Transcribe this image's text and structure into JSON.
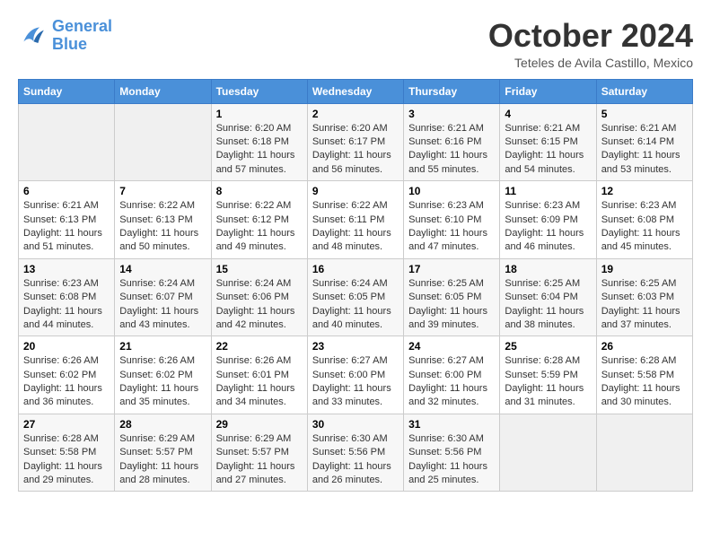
{
  "header": {
    "logo_line1": "General",
    "logo_line2": "Blue",
    "month": "October 2024",
    "location": "Teteles de Avila Castillo, Mexico"
  },
  "weekdays": [
    "Sunday",
    "Monday",
    "Tuesday",
    "Wednesday",
    "Thursday",
    "Friday",
    "Saturday"
  ],
  "weeks": [
    [
      {
        "day": "",
        "empty": true
      },
      {
        "day": "",
        "empty": true
      },
      {
        "day": "1",
        "sunrise": "6:20 AM",
        "sunset": "6:18 PM",
        "daylight": "11 hours and 57 minutes."
      },
      {
        "day": "2",
        "sunrise": "6:20 AM",
        "sunset": "6:17 PM",
        "daylight": "11 hours and 56 minutes."
      },
      {
        "day": "3",
        "sunrise": "6:21 AM",
        "sunset": "6:16 PM",
        "daylight": "11 hours and 55 minutes."
      },
      {
        "day": "4",
        "sunrise": "6:21 AM",
        "sunset": "6:15 PM",
        "daylight": "11 hours and 54 minutes."
      },
      {
        "day": "5",
        "sunrise": "6:21 AM",
        "sunset": "6:14 PM",
        "daylight": "11 hours and 53 minutes."
      }
    ],
    [
      {
        "day": "6",
        "sunrise": "6:21 AM",
        "sunset": "6:13 PM",
        "daylight": "11 hours and 51 minutes."
      },
      {
        "day": "7",
        "sunrise": "6:22 AM",
        "sunset": "6:13 PM",
        "daylight": "11 hours and 50 minutes."
      },
      {
        "day": "8",
        "sunrise": "6:22 AM",
        "sunset": "6:12 PM",
        "daylight": "11 hours and 49 minutes."
      },
      {
        "day": "9",
        "sunrise": "6:22 AM",
        "sunset": "6:11 PM",
        "daylight": "11 hours and 48 minutes."
      },
      {
        "day": "10",
        "sunrise": "6:23 AM",
        "sunset": "6:10 PM",
        "daylight": "11 hours and 47 minutes."
      },
      {
        "day": "11",
        "sunrise": "6:23 AM",
        "sunset": "6:09 PM",
        "daylight": "11 hours and 46 minutes."
      },
      {
        "day": "12",
        "sunrise": "6:23 AM",
        "sunset": "6:08 PM",
        "daylight": "11 hours and 45 minutes."
      }
    ],
    [
      {
        "day": "13",
        "sunrise": "6:23 AM",
        "sunset": "6:08 PM",
        "daylight": "11 hours and 44 minutes."
      },
      {
        "day": "14",
        "sunrise": "6:24 AM",
        "sunset": "6:07 PM",
        "daylight": "11 hours and 43 minutes."
      },
      {
        "day": "15",
        "sunrise": "6:24 AM",
        "sunset": "6:06 PM",
        "daylight": "11 hours and 42 minutes."
      },
      {
        "day": "16",
        "sunrise": "6:24 AM",
        "sunset": "6:05 PM",
        "daylight": "11 hours and 40 minutes."
      },
      {
        "day": "17",
        "sunrise": "6:25 AM",
        "sunset": "6:05 PM",
        "daylight": "11 hours and 39 minutes."
      },
      {
        "day": "18",
        "sunrise": "6:25 AM",
        "sunset": "6:04 PM",
        "daylight": "11 hours and 38 minutes."
      },
      {
        "day": "19",
        "sunrise": "6:25 AM",
        "sunset": "6:03 PM",
        "daylight": "11 hours and 37 minutes."
      }
    ],
    [
      {
        "day": "20",
        "sunrise": "6:26 AM",
        "sunset": "6:02 PM",
        "daylight": "11 hours and 36 minutes."
      },
      {
        "day": "21",
        "sunrise": "6:26 AM",
        "sunset": "6:02 PM",
        "daylight": "11 hours and 35 minutes."
      },
      {
        "day": "22",
        "sunrise": "6:26 AM",
        "sunset": "6:01 PM",
        "daylight": "11 hours and 34 minutes."
      },
      {
        "day": "23",
        "sunrise": "6:27 AM",
        "sunset": "6:00 PM",
        "daylight": "11 hours and 33 minutes."
      },
      {
        "day": "24",
        "sunrise": "6:27 AM",
        "sunset": "6:00 PM",
        "daylight": "11 hours and 32 minutes."
      },
      {
        "day": "25",
        "sunrise": "6:28 AM",
        "sunset": "5:59 PM",
        "daylight": "11 hours and 31 minutes."
      },
      {
        "day": "26",
        "sunrise": "6:28 AM",
        "sunset": "5:58 PM",
        "daylight": "11 hours and 30 minutes."
      }
    ],
    [
      {
        "day": "27",
        "sunrise": "6:28 AM",
        "sunset": "5:58 PM",
        "daylight": "11 hours and 29 minutes."
      },
      {
        "day": "28",
        "sunrise": "6:29 AM",
        "sunset": "5:57 PM",
        "daylight": "11 hours and 28 minutes."
      },
      {
        "day": "29",
        "sunrise": "6:29 AM",
        "sunset": "5:57 PM",
        "daylight": "11 hours and 27 minutes."
      },
      {
        "day": "30",
        "sunrise": "6:30 AM",
        "sunset": "5:56 PM",
        "daylight": "11 hours and 26 minutes."
      },
      {
        "day": "31",
        "sunrise": "6:30 AM",
        "sunset": "5:56 PM",
        "daylight": "11 hours and 25 minutes."
      },
      {
        "day": "",
        "empty": true
      },
      {
        "day": "",
        "empty": true
      }
    ]
  ]
}
